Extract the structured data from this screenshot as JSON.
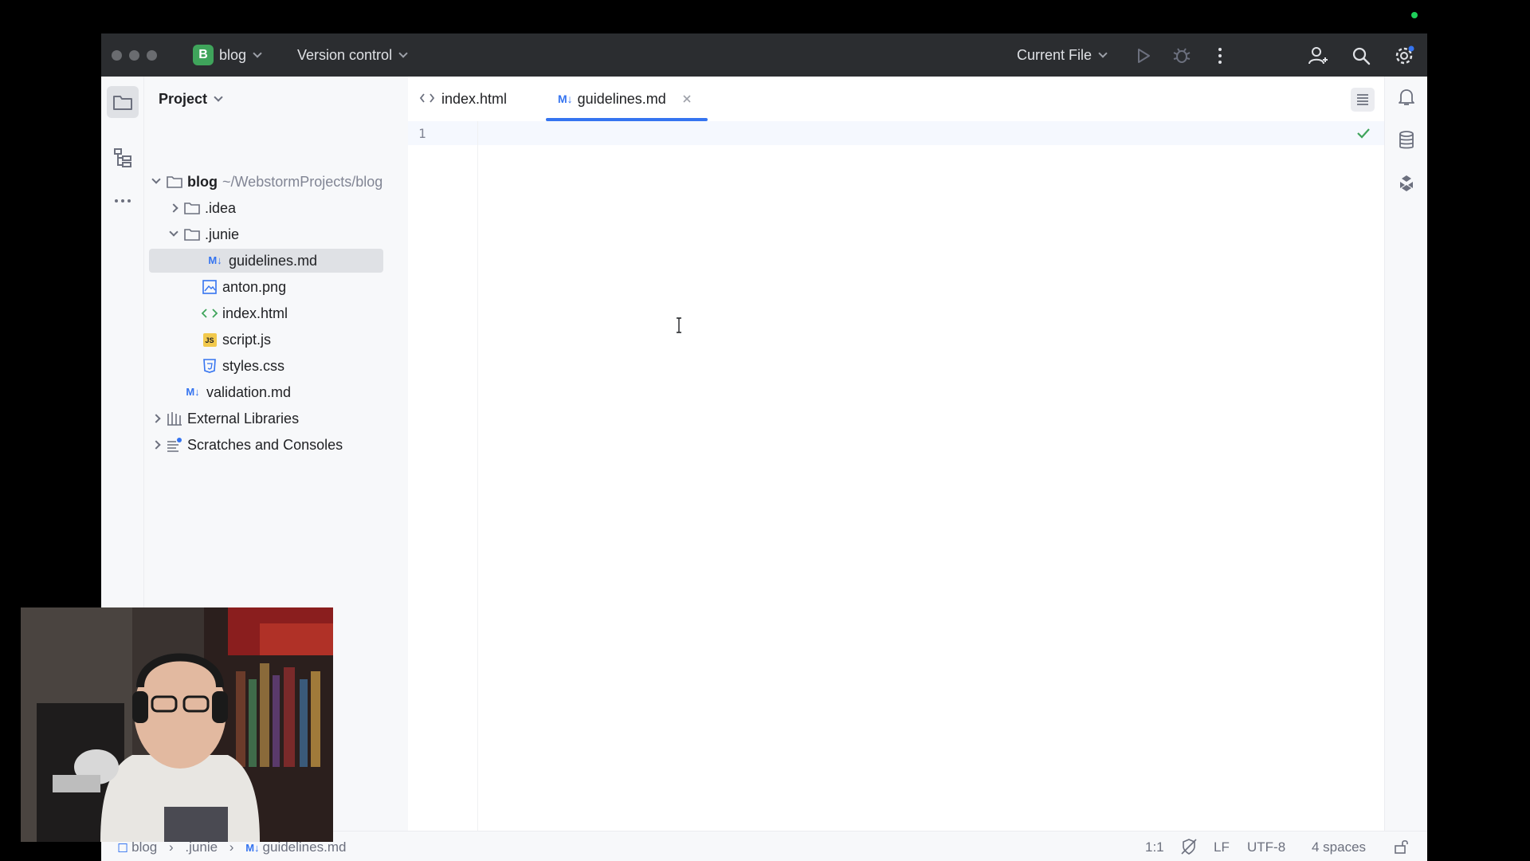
{
  "titlebar": {
    "project_badge": "B",
    "project_name": "blog",
    "vcs_label": "Version control",
    "run_config": "Current File"
  },
  "project_panel": {
    "title": "Project",
    "tree": [
      {
        "label": "blog",
        "path": "~/WebstormProjects/blog",
        "type": "folder",
        "expanded": true
      },
      {
        "label": ".idea",
        "type": "folder",
        "expanded": false
      },
      {
        "label": ".junie",
        "type": "folder",
        "expanded": true
      },
      {
        "label": "guidelines.md",
        "type": "markdown",
        "selected": true
      },
      {
        "label": "anton.png",
        "type": "image"
      },
      {
        "label": "index.html",
        "type": "html"
      },
      {
        "label": "script.js",
        "type": "js"
      },
      {
        "label": "styles.css",
        "type": "css"
      },
      {
        "label": "validation.md",
        "type": "markdown"
      },
      {
        "label": "External Libraries",
        "type": "library"
      },
      {
        "label": "Scratches and Consoles",
        "type": "scratches"
      }
    ]
  },
  "editor": {
    "tabs": [
      {
        "label": "index.html",
        "type": "html",
        "active": false
      },
      {
        "label": "guidelines.md",
        "type": "markdown",
        "active": true
      }
    ],
    "line_numbers": [
      "1"
    ]
  },
  "statusbar": {
    "breadcrumb": [
      "blog",
      ".junie",
      "guidelines.md"
    ],
    "position": "1:1",
    "line_separator": "LF",
    "encoding": "UTF-8",
    "indent": "4 spaces"
  },
  "icons": {
    "md_badge": "M↓",
    "js_badge": "JS"
  },
  "colors": {
    "accent": "#3574f0",
    "titlebar_bg": "#2b2d30",
    "project_badge": "#3fa45b",
    "check": "#3fa45b"
  }
}
